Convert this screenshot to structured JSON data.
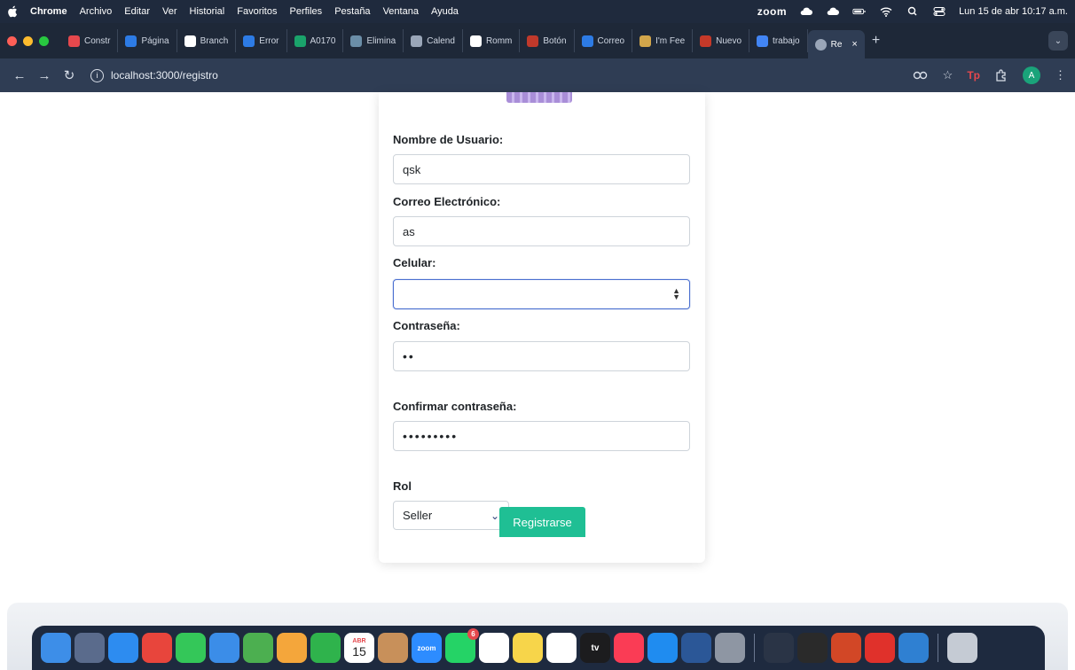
{
  "menubar": {
    "app": "Chrome",
    "items": [
      "Archivo",
      "Editar",
      "Ver",
      "Historial",
      "Favoritos",
      "Perfiles",
      "Pestaña",
      "Ventana",
      "Ayuda"
    ],
    "zoom": "zoom",
    "clock": "Lun 15 de abr 10:17 a.m."
  },
  "tabs": [
    {
      "label": "Constr",
      "color": "#e5484d"
    },
    {
      "label": "Página",
      "color": "#2d7be5"
    },
    {
      "label": "Branch",
      "color": "#ffffff"
    },
    {
      "label": "Error",
      "color": "#2d7be5"
    },
    {
      "label": "A0170",
      "color": "#1aa36b"
    },
    {
      "label": "Elimina",
      "color": "#6b8ea8"
    },
    {
      "label": "Calend",
      "color": "#9aa6b8"
    },
    {
      "label": "Romm",
      "color": "#ffffff"
    },
    {
      "label": "Botón",
      "color": "#c0392b"
    },
    {
      "label": "Correo",
      "color": "#2d7be5"
    },
    {
      "label": "I'm Fee",
      "color": "#d2a64b"
    },
    {
      "label": "Nuevo",
      "color": "#c53929"
    },
    {
      "label": "trabajo",
      "color": "#4285f4"
    }
  ],
  "active_tab": {
    "label": "Re",
    "close": "×"
  },
  "new_tab": "+",
  "tab_menu": "⌄",
  "address": {
    "url": "localhost:3000/registro"
  },
  "toolbar": {
    "ext_label": "Tp",
    "avatar": "A"
  },
  "form": {
    "username_label": "Nombre de Usuario:",
    "username_value": "qsk",
    "email_label": "Correo Electrónico:",
    "email_value": "as",
    "phone_label": "Celular:",
    "phone_value": "",
    "password_label": "Contraseña:",
    "password_value": "••",
    "confirm_label": "Confirmar contraseña:",
    "confirm_value": "•••••••••",
    "role_label": "Rol",
    "role_value": "Seller",
    "submit_label": "Registrarse"
  },
  "dock": {
    "calendar_month": "ABR",
    "calendar_day": "15",
    "zoom_app": "zoom",
    "tv_app": "tv",
    "whatsapp_badge": "6",
    "apps": [
      {
        "name": "finder",
        "color": "#3d8ee8"
      },
      {
        "name": "launchpad",
        "color": "#5a6b8c"
      },
      {
        "name": "safari",
        "color": "#2d8cf0"
      },
      {
        "name": "chrome",
        "color": "#e8453c"
      },
      {
        "name": "messages",
        "color": "#34c759"
      },
      {
        "name": "mail",
        "color": "#3b8de8"
      },
      {
        "name": "maps",
        "color": "#4caf50"
      },
      {
        "name": "photos",
        "color": "#f4a63b"
      },
      {
        "name": "facetime",
        "color": "#2fb34c"
      },
      {
        "name": "calendar",
        "color": "#ffffff"
      },
      {
        "name": "contacts",
        "color": "#c8905a"
      },
      {
        "name": "zoom",
        "color": "#2d8cff"
      },
      {
        "name": "whatsapp",
        "color": "#25d366"
      },
      {
        "name": "reminders",
        "color": "#ffffff"
      },
      {
        "name": "notes",
        "color": "#f7d54a"
      },
      {
        "name": "freeform",
        "color": "#ffffff"
      },
      {
        "name": "tv",
        "color": "#1c1c1e"
      },
      {
        "name": "music",
        "color": "#fa3c55"
      },
      {
        "name": "appstore",
        "color": "#1f8cf0"
      },
      {
        "name": "word",
        "color": "#2b5797"
      },
      {
        "name": "settings",
        "color": "#8e96a3"
      },
      {
        "name": "activity-monitor",
        "color": "#2a3446"
      },
      {
        "name": "terminal",
        "color": "#2a2a2a"
      },
      {
        "name": "powerpoint",
        "color": "#d24726"
      },
      {
        "name": "acrobat",
        "color": "#e0312b"
      },
      {
        "name": "vscode",
        "color": "#2f80d2"
      },
      {
        "name": "trash",
        "color": "#c5cbd4"
      }
    ]
  }
}
